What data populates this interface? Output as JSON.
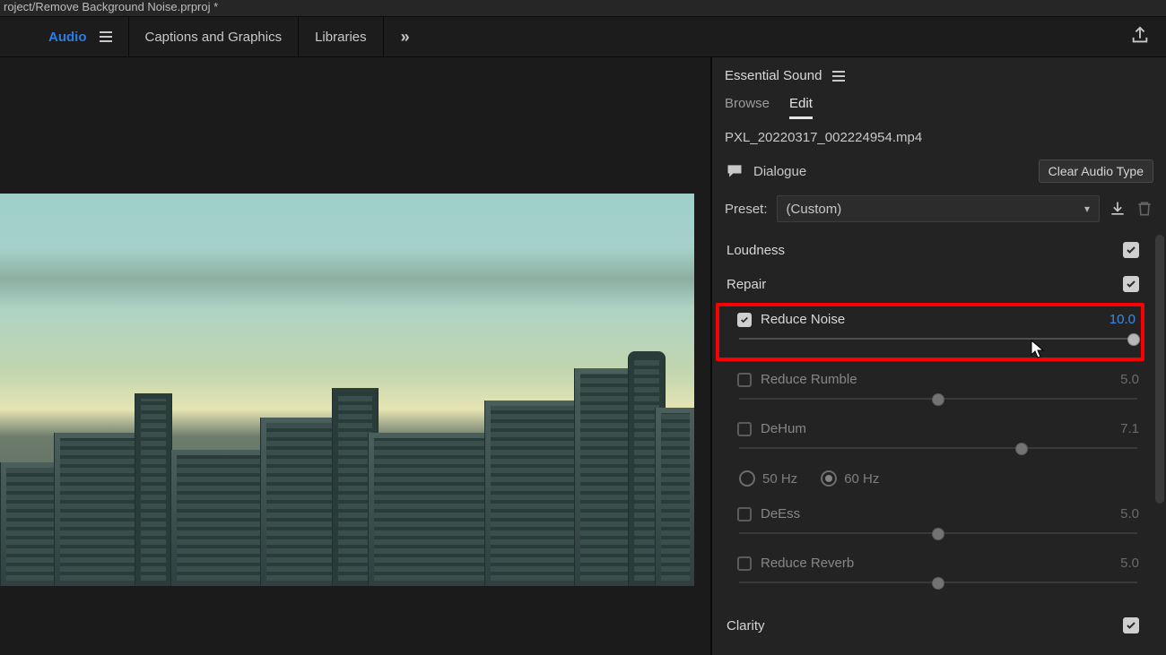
{
  "titlebar": "roject/Remove Background Noise.prproj *",
  "workspace": {
    "tabs": [
      "Audio",
      "Captions and Graphics",
      "Libraries"
    ],
    "active": 0
  },
  "panel": {
    "title": "Essential Sound",
    "tabs": {
      "browse": "Browse",
      "edit": "Edit",
      "active": "edit"
    },
    "clip": "PXL_20220317_002224954.mp4",
    "audio_type": "Dialogue",
    "clear_btn": "Clear Audio Type",
    "preset_label": "Preset:",
    "preset_value": "(Custom)",
    "sections": {
      "loudness": {
        "title": "Loudness",
        "enabled": true
      },
      "repair": {
        "title": "Repair",
        "enabled": true
      },
      "clarity": {
        "title": "Clarity",
        "enabled": true
      }
    },
    "repair": {
      "reduce_noise": {
        "label": "Reduce Noise",
        "checked": true,
        "value": "10.0",
        "pos": 100
      },
      "reduce_rumble": {
        "label": "Reduce Rumble",
        "checked": false,
        "value": "5.0",
        "pos": 50
      },
      "dehum": {
        "label": "DeHum",
        "checked": false,
        "value": "7.1",
        "pos": 71,
        "radios": {
          "a": "50 Hz",
          "b": "60 Hz",
          "selected": "b"
        }
      },
      "deess": {
        "label": "DeEss",
        "checked": false,
        "value": "5.0",
        "pos": 50
      },
      "reduce_reverb": {
        "label": "Reduce Reverb",
        "checked": false,
        "value": "5.0",
        "pos": 50
      }
    }
  }
}
